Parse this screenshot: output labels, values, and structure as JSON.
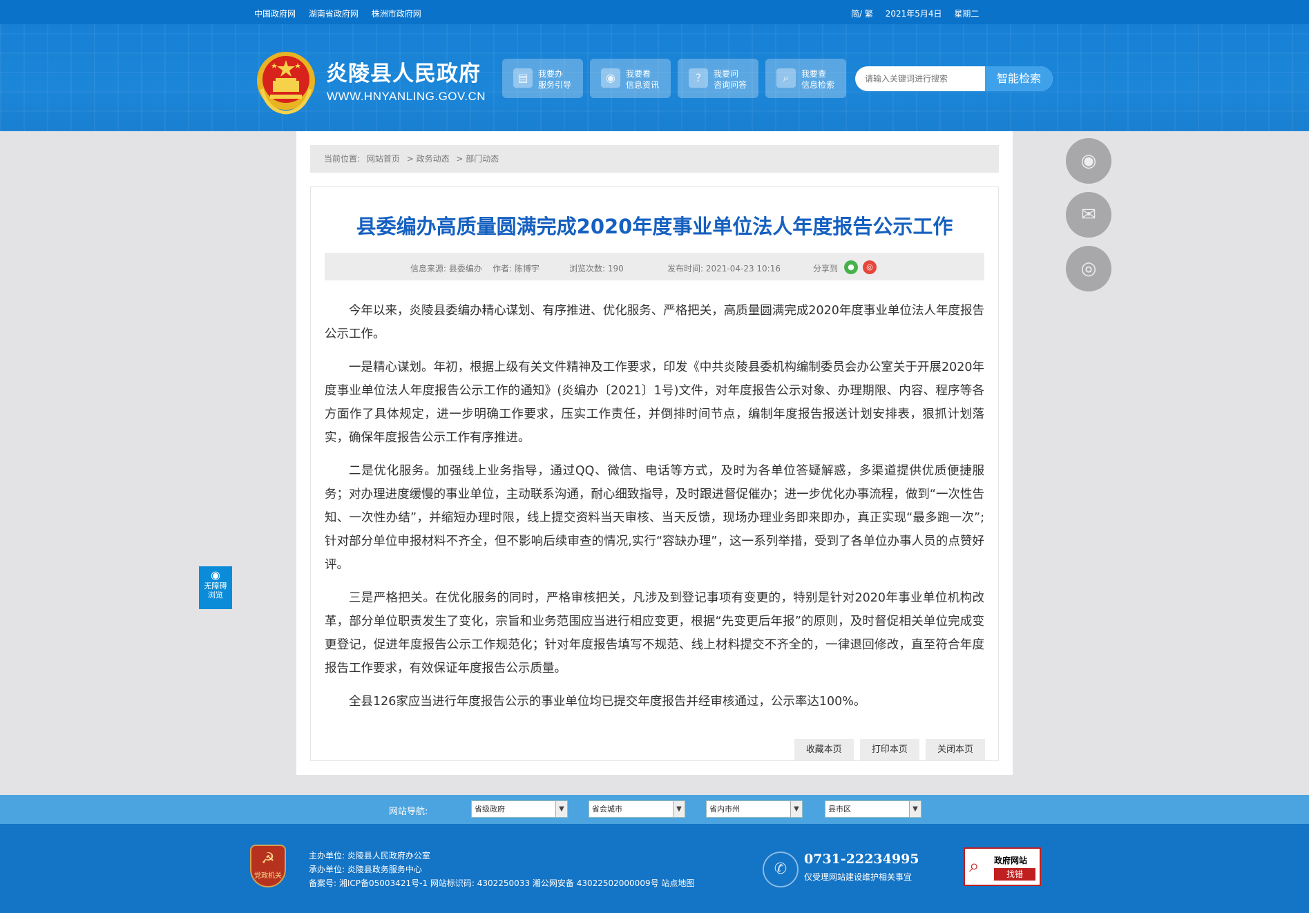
{
  "topbar": {
    "links": [
      "中国政府网",
      "湖南省政府网",
      "株洲市政府网"
    ],
    "lang": "简/ 繁",
    "date": "2021年5月4日",
    "weekday": "星期二"
  },
  "header": {
    "site_title": "炎陵县人民政府",
    "site_url": "WWW.HNYANLING.GOV.CN",
    "nav": [
      {
        "icon": "document-icon",
        "line1": "我要办",
        "line2": "服务引导"
      },
      {
        "icon": "eye-icon",
        "line1": "我要看",
        "line2": "信息资讯"
      },
      {
        "icon": "question-icon",
        "line1": "我要问",
        "line2": "咨询问答"
      },
      {
        "icon": "search-icon",
        "line1": "我要查",
        "line2": "信息检索"
      }
    ],
    "search_placeholder": "请输入关键词进行搜索",
    "search_button": "智能检索"
  },
  "breadcrumb": {
    "label": "当前位置:",
    "items": [
      "网站首页",
      "> 政务动态",
      "> 部门动态"
    ]
  },
  "article": {
    "title": "县委编办高质量圆满完成2020年度事业单位法人年度报告公示工作",
    "meta": {
      "source": "信息来源: 县委编办",
      "author": "作者: 陈博宇",
      "views": "浏览次数: 190",
      "published": "发布时间: 2021-04-23 10:16",
      "share": "分享到"
    },
    "paragraphs": [
      "今年以来，炎陵县委编办精心谋划、有序推进、优化服务、严格把关，高质量圆满完成2020年度事业单位法人年度报告公示工作。",
      "一是精心谋划。年初，根据上级有关文件精神及工作要求，印发《中共炎陵县委机构编制委员会办公室关于开展2020年度事业单位法人年度报告公示工作的通知》(炎编办〔2021〕1号)文件，对年度报告公示对象、办理期限、内容、程序等各方面作了具体规定，进一步明确工作要求，压实工作责任，并倒排时间节点，编制年度报告报送计划安排表，狠抓计划落实，确保年度报告公示工作有序推进。",
      "二是优化服务。加强线上业务指导，通过QQ、微信、电话等方式，及时为各单位答疑解惑，多渠道提供优质便捷服务；对办理进度缓慢的事业单位，主动联系沟通，耐心细致指导，及时跟进督促催办；进一步优化办事流程，做到“一次性告知、一次性办结”，并缩短办理时限，线上提交资料当天审核、当天反馈，现场办理业务即来即办，真正实现“最多跑一次”;针对部分单位申报材料不齐全，但不影响后续审查的情况,实行“容缺办理”，这一系列举措，受到了各单位办事人员的点赞好评。",
      "三是严格把关。在优化服务的同时，严格审核把关，凡涉及到登记事项有变更的，特别是针对2020年事业单位机构改革，部分单位职责发生了变化，宗旨和业务范围应当进行相应变更，根据“先变更后年报”的原则，及时督促相关单位完成变更登记，促进年度报告公示工作规范化；针对年度报告填写不规范、线上材料提交不齐全的，一律退回修改，直至符合年度报告工作要求，有效保证年度报告公示质量。",
      "全县126家应当进行年度报告公示的事业单位均已提交年度报告并经审核通过，公示率达100%。"
    ],
    "tools": [
      "收藏本页",
      "打印本页",
      "关闭本页"
    ]
  },
  "floating": [
    "eye-icon",
    "wechat-icon",
    "weibo-icon"
  ],
  "accessibility": {
    "label1": "无障碍",
    "label2": "浏览"
  },
  "sitenav": {
    "label": "网站导航:",
    "selects": [
      "省级政府",
      "省会城市",
      "省内市州",
      "县市区"
    ]
  },
  "footer": {
    "party_label": "党政机关",
    "host": "主办单位: 炎陵县人民政府办公室",
    "operator": "承办单位: 炎陵县政务服务中心",
    "record": "备案号: 湘ICP备05003421号-1 网站标识码: 4302250033 湘公网安备 43022502000009号 站点地图",
    "phone": "0731-22234995",
    "phone_note": "仅受理网站建设维护相关事宜",
    "err_title": "政府网站",
    "err_label": "找错"
  },
  "colors": {
    "primary": "#1780d5",
    "title": "#1560c0",
    "footer": "#1474c6",
    "nav": "#4ba4df"
  }
}
